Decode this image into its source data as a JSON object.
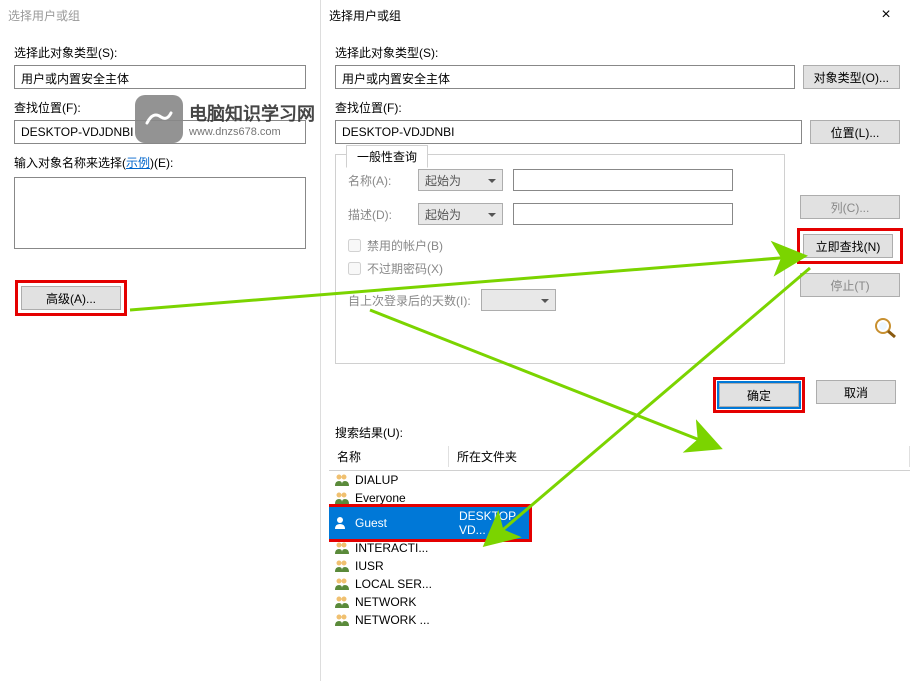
{
  "back_dialog": {
    "title": "选择用户或组",
    "object_type_label": "选择此对象类型(S):",
    "object_type_value": "用户或内置安全主体",
    "location_label": "查找位置(F):",
    "location_value": "DESKTOP-VDJDNBI",
    "enter_names_label_pre": "输入对象名称来选择(",
    "enter_names_link": "示例",
    "enter_names_label_post": ")(E):",
    "advanced_btn": "高级(A)..."
  },
  "front_dialog": {
    "title": "选择用户或组",
    "object_type_label": "选择此对象类型(S):",
    "object_type_value": "用户或内置安全主体",
    "object_type_btn": "对象类型(O)...",
    "location_label": "查找位置(F):",
    "location_value": "DESKTOP-VDJDNBI",
    "location_btn": "位置(L)...",
    "common_tab": "一般性查询",
    "name_label": "名称(A):",
    "name_mode": "起始为",
    "desc_label": "描述(D):",
    "desc_mode": "起始为",
    "disabled_accounts": "禁用的帐户(B)",
    "no_expire_pwd": "不过期密码(X)",
    "days_since_login": "自上次登录后的天数(I):",
    "columns_btn": "列(C)...",
    "find_now_btn": "立即查找(N)",
    "stop_btn": "停止(T)",
    "ok_btn": "确定",
    "cancel_btn": "取消",
    "results_label": "搜索结果(U):",
    "col_name": "名称",
    "col_folder": "所在文件夹",
    "results": [
      {
        "name": "DIALUP",
        "folder": "",
        "type": "group"
      },
      {
        "name": "Everyone",
        "folder": "",
        "type": "group"
      },
      {
        "name": "Guest",
        "folder": "DESKTOP-VD...",
        "type": "user",
        "selected": true
      },
      {
        "name": "INTERACTI...",
        "folder": "",
        "type": "group"
      },
      {
        "name": "IUSR",
        "folder": "",
        "type": "group"
      },
      {
        "name": "LOCAL SER...",
        "folder": "",
        "type": "group"
      },
      {
        "name": "NETWORK",
        "folder": "",
        "type": "group"
      },
      {
        "name": "NETWORK ...",
        "folder": "",
        "type": "group"
      }
    ]
  },
  "watermark": {
    "line1": "电脑知识学习网",
    "line2": "www.dnzs678.com"
  }
}
